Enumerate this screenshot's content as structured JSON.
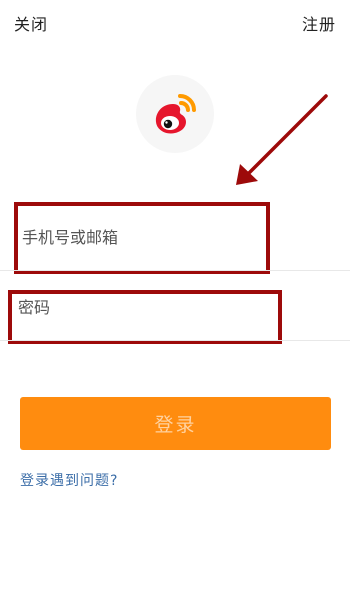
{
  "topbar": {
    "close_label": "关闭",
    "register_label": "注册"
  },
  "logo": {
    "icon": "weibo-logo-icon",
    "colors": {
      "eye": "#e6162d",
      "waves": "#ff9a00",
      "background": "#f6f6f6"
    }
  },
  "form": {
    "phone_placeholder": "手机号或邮箱",
    "phone_value": "",
    "password_placeholder": "密码",
    "password_value": "",
    "login_label": "登录"
  },
  "help": {
    "link_label": "登录遇到问题?"
  },
  "colors": {
    "accent": "#ff8c0f",
    "annotation": "#9d0a0a",
    "link": "#3c6ea8"
  }
}
